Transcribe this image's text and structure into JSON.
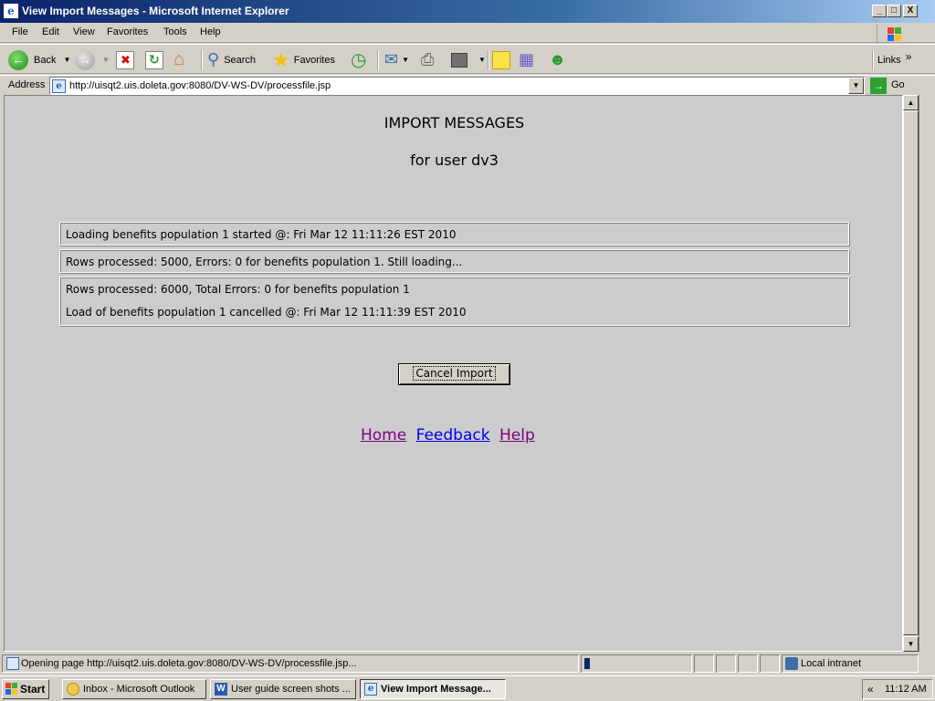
{
  "window": {
    "title": "View Import Messages - Microsoft Internet Explorer",
    "minimize": "_",
    "maximize": "□",
    "close": "X"
  },
  "menu": [
    "File",
    "Edit",
    "View",
    "Favorites",
    "Tools",
    "Help"
  ],
  "toolbar": {
    "back_label": "Back",
    "search_label": "Search",
    "favorites_label": "Favorites",
    "links_label": "Links",
    "more_glyph": "»"
  },
  "address": {
    "label": "Address",
    "url": "http://uisqt2.uis.doleta.gov:8080/DV-WS-DV/processfile.jsp",
    "go_label": "Go"
  },
  "page": {
    "title": "IMPORT MESSAGES",
    "subtitle": "for user dv3",
    "messages": [
      "Loading benefits population 1 started @: Fri Mar 12 11:11:26 EST 2010",
      "Rows processed: 5000, Errors: 0 for benefits population 1. Still loading...",
      "Rows processed: 6000, Total Errors: 0 for benefits population 1",
      "Load of benefits population 1 cancelled @: Fri Mar 12 11:11:39 EST 2010"
    ],
    "cancel_button": "Cancel Import",
    "links": {
      "home": "Home",
      "feedback": "Feedback",
      "help": "Help"
    }
  },
  "status": {
    "text": "Opening page http://uisqt2.uis.doleta.gov:8080/DV-WS-DV/processfile.jsp...",
    "zone": "Local intranet"
  },
  "taskbar": {
    "start": "Start",
    "tasks": [
      "Inbox - Microsoft Outlook",
      "User guide screen shots ...",
      "View Import Message..."
    ],
    "tray_glyph": "«",
    "clock": "11:12 AM"
  },
  "colors": {
    "visited_link": "#800080",
    "unvisited_link": "#0000ee",
    "title_bar": "#0a246a"
  }
}
